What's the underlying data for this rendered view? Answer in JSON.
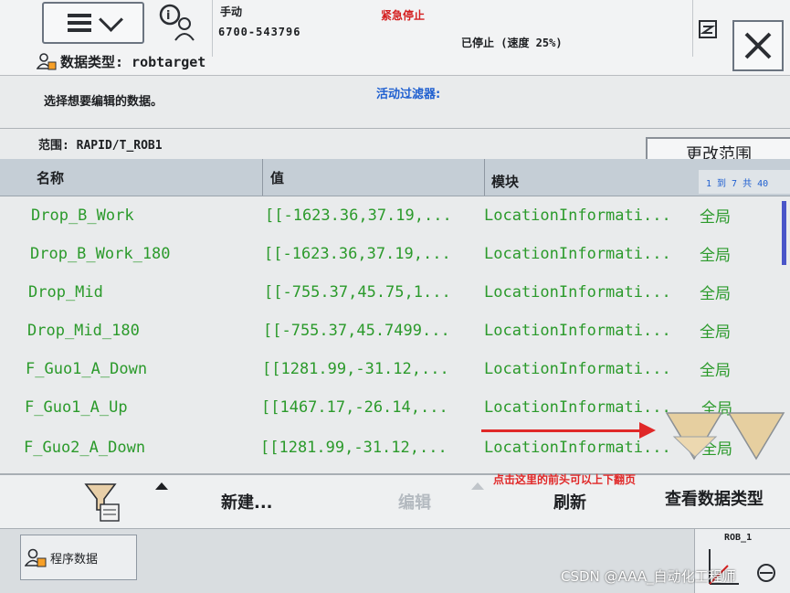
{
  "status": {
    "mode": "手动",
    "serial": "6700-543796",
    "estop": "紧急停止",
    "stopped": "已停止 (速度 25%)"
  },
  "data_type_row": {
    "label": "数据类型: robtarget"
  },
  "instruction": "选择想要编辑的数据。",
  "filter_label": "活动过滤器:",
  "scope_label": "范围: RAPID/T_ROB1",
  "change_scope_button": "更改范围",
  "table": {
    "headers": [
      "名称",
      "值",
      "模块"
    ],
    "page_count": "1 到 7 共 40",
    "rows": [
      {
        "name": "Drop_B_Work",
        "value": "[[-1623.36,37.19,...",
        "module": "LocationInformati...",
        "scope": "全局"
      },
      {
        "name": "Drop_B_Work_180",
        "value": "[[-1623.36,37.19,...",
        "module": "LocationInformati...",
        "scope": "全局"
      },
      {
        "name": "Drop_Mid",
        "value": "[[-755.37,45.75,1...",
        "module": "LocationInformati...",
        "scope": "全局"
      },
      {
        "name": "Drop_Mid_180",
        "value": "[[-755.37,45.7499...",
        "module": "LocationInformati...",
        "scope": "全局"
      },
      {
        "name": "F_Guo1_A_Down",
        "value": "[[1281.99,-31.12,...",
        "module": "LocationInformati...",
        "scope": "全局"
      },
      {
        "name": "F_Guo1_A_Up",
        "value": "[[1467.17,-26.14,...",
        "module": "LocationInformati...",
        "scope": "全局"
      },
      {
        "name": "F_Guo2_A_Down",
        "value": "[[1281.99,-31.12,...",
        "module": "LocationInformati...",
        "scope": "全局"
      }
    ]
  },
  "annotation_note": "点击这里的前头可以上下翻页",
  "toolbar": {
    "new_label": "新建...",
    "edit_label": "编辑",
    "refresh_label": "刷新",
    "view_types_label": "查看数据类型"
  },
  "taskbar": {
    "program_data_label": "程序数据",
    "rob_label": "ROB_1"
  },
  "watermark": "CSDN @AAA_自动化工程师",
  "colors": {
    "estop": "#d42020",
    "filter": "#2060d0",
    "row_text": "#2b9a2b",
    "annotation": "#e02828"
  }
}
